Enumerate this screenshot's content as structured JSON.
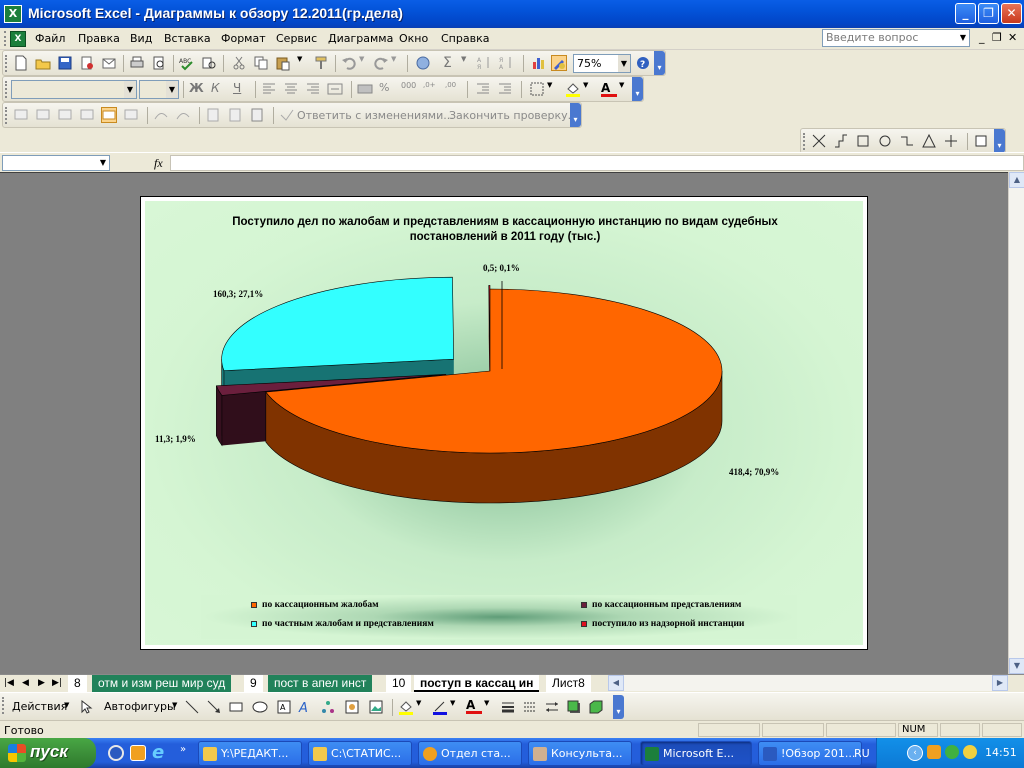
{
  "window": {
    "title": "Microsoft Excel - Диаграммы к обзору 12.2011(гр.дела)",
    "app_icon_text": "X"
  },
  "menu": {
    "items": [
      "Файл",
      "Правка",
      "Вид",
      "Вставка",
      "Формат",
      "Сервис",
      "Диаграмма",
      "Окно",
      "Справка"
    ],
    "ask_placeholder": "Введите вопрос"
  },
  "toolbar": {
    "zoom": "75%",
    "reply_label": "Ответить с изменениями...",
    "finish_label": "Закончить проверку..."
  },
  "formula": {
    "fx_label": "fx"
  },
  "chart_data": {
    "type": "pie",
    "title": "Поступило дел по жалобам и представлениям в кассационную инстанцию по видам судебных постановлений в 2011 году (тыс.)",
    "categories": [
      "по кассационным жалобам",
      "по кассационным представлениям",
      "по частным жалобам и представлениям",
      "поступило из надзорной инстанции"
    ],
    "values": [
      418.4,
      11.3,
      160.3,
      0.5
    ],
    "percents": [
      70.9,
      1.9,
      27.1,
      0.1
    ],
    "labels": [
      "418,4; 70,9%",
      "11,3; 1,9%",
      "160,3; 27,1%",
      "0,5; 0,1%"
    ],
    "colors": [
      "#ff6600",
      "#6b1f3d",
      "#33ffff",
      "#e01020"
    ],
    "legend_position": "bottom"
  },
  "sheets": {
    "tabs": [
      "8",
      "отм и изм реш мир суд",
      "9",
      "пост в апел инст",
      "10",
      "поступ в кассац ин",
      "Лист8"
    ]
  },
  "drawing": {
    "actions_label": "Действия",
    "autoshapes_label": "Автофигуры"
  },
  "status": {
    "ready": "Готово",
    "num": "NUM"
  },
  "taskbar": {
    "start_label": "пуск",
    "tasks": [
      "Y:\\РЕДАКТ...",
      "C:\\СТАТИС...",
      "Отдел ста...",
      "Консульта...",
      "Microsoft E...",
      "!Обзор 201..."
    ],
    "lang": "RU",
    "clock": "14:51"
  }
}
